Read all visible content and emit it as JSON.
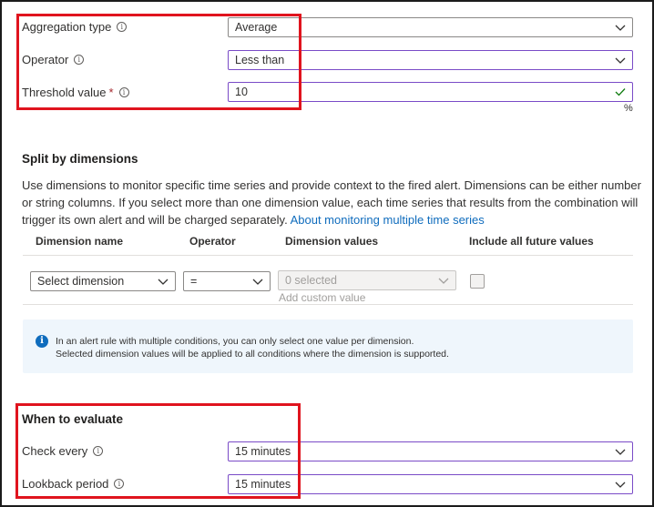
{
  "condition": {
    "aggregation_type": {
      "label": "Aggregation type",
      "value": "Average"
    },
    "operator": {
      "label": "Operator",
      "value": "Less than"
    },
    "threshold": {
      "label": "Threshold value",
      "required_mark": "*",
      "value": "10",
      "unit": "%"
    }
  },
  "split": {
    "heading": "Split by dimensions",
    "description": "Use dimensions to monitor specific time series and provide context to the fired alert. Dimensions can be either number or string columns. If you select more than one dimension value, each time series that results from the combination will trigger its own alert and will be charged separately.",
    "link_text": "About monitoring multiple time series",
    "columns": [
      "Dimension name",
      "Operator",
      "Dimension values",
      "Include all future values"
    ],
    "row": {
      "dimension_placeholder": "Select dimension",
      "operator": "=",
      "values_placeholder": "0 selected",
      "add_custom": "Add custom value"
    },
    "info_lines": [
      "In an alert rule with multiple conditions, you can only select one value per dimension.",
      "Selected dimension values will be applied to all conditions where the dimension is supported."
    ]
  },
  "evaluate": {
    "heading": "When to evaluate",
    "check_every": {
      "label": "Check every",
      "value": "15 minutes"
    },
    "lookback": {
      "label": "Lookback period",
      "value": "15 minutes"
    }
  },
  "colors": {
    "highlight": "#e0141e",
    "focus_border": "#7a4bc7",
    "link": "#0f6cbd",
    "valid_check": "#107c10"
  }
}
